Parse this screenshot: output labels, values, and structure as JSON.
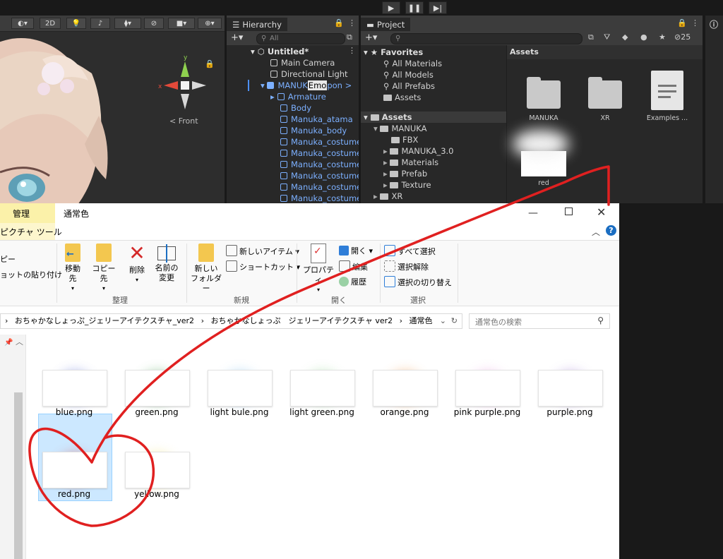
{
  "toolbar": {
    "play_icon": "play-icon",
    "pause_icon": "pause-icon",
    "step_icon": "step-icon"
  },
  "scene": {
    "mode_2d": "2D",
    "gizmo_label": "Front"
  },
  "hierarchy": {
    "tab_label": "Hierarchy",
    "search_placeholder": "All",
    "scene_name": "Untitled*",
    "items": [
      "Main Camera",
      "Directional Light"
    ],
    "selected_prefix": "MANUK",
    "selected_highlight": "Emo",
    "selected_suffix": "pon",
    "children": [
      "Armature",
      "Body",
      "Manuka_atama",
      "Manuka_body",
      "Manuka_costume",
      "Manuka_costume",
      "Manuka_costume",
      "Manuka_costume",
      "Manuka_costume",
      "Manuka_costume"
    ]
  },
  "project": {
    "tab_label": "Project",
    "hidden_count": "25",
    "favorites_label": "Favorites",
    "favorites": [
      "All Materials",
      "All Models",
      "All Prefabs",
      "Assets"
    ],
    "assets_label": "Assets",
    "tree": [
      {
        "label": "MANUKA",
        "indent": 1
      },
      {
        "label": "FBX",
        "indent": 2
      },
      {
        "label": "MANUKA_3.0",
        "indent": 2
      },
      {
        "label": "Materials",
        "indent": 2
      },
      {
        "label": "Prefab",
        "indent": 2
      },
      {
        "label": "Texture",
        "indent": 2
      },
      {
        "label": "XR",
        "indent": 1
      }
    ],
    "grid_header": "Assets",
    "grid": [
      "MANUKA",
      "XR",
      "Examples ...",
      "red"
    ]
  },
  "explorer": {
    "manage_tab": "管理",
    "title": "通常色",
    "picture_tools": "ピクチャ ツール",
    "clipboard": {
      "copy": "ピー",
      "paste_shortcut": "ョットの貼り付け"
    },
    "organize": {
      "move": "移動先",
      "copy": "コピー先",
      "delete": "削除",
      "rename_l1": "名前の",
      "rename_l2": "変更",
      "group": "整理"
    },
    "new": {
      "new_folder_l1": "新しい",
      "new_folder_l2": "フォルダー",
      "new_item": "新しいアイテム",
      "shortcut": "ショートカット",
      "group": "新規"
    },
    "open": {
      "properties": "プロパティ",
      "open": "開く",
      "edit": "編集",
      "history": "履歴",
      "group": "開く"
    },
    "select": {
      "select_all": "すべて選択",
      "deselect": "選択解除",
      "invert": "選択の切り替え",
      "group": "選択"
    },
    "breadcrumb": [
      "おちゃかなしょっぷ_ジェリーアイテクスチャ_ver2",
      "おちゃかなしょっぷ　ジェリーアイテクスチャ ver2",
      "通常色"
    ],
    "search_placeholder": "通常色の検索",
    "files": [
      "blue.png",
      "green.png",
      "light bule.png",
      "light green.png",
      "orange.png",
      "pink purple.png",
      "purple.png",
      "red.png",
      "yellow.png"
    ],
    "colors": [
      "#6a7bd8",
      "#5fae67",
      "#8ec6ef",
      "#9bd79b",
      "#f0a05a",
      "#e7a4e0",
      "#a98ad8",
      "#e05a5a",
      "#efe17a"
    ]
  },
  "annotation_color": "#e02020"
}
